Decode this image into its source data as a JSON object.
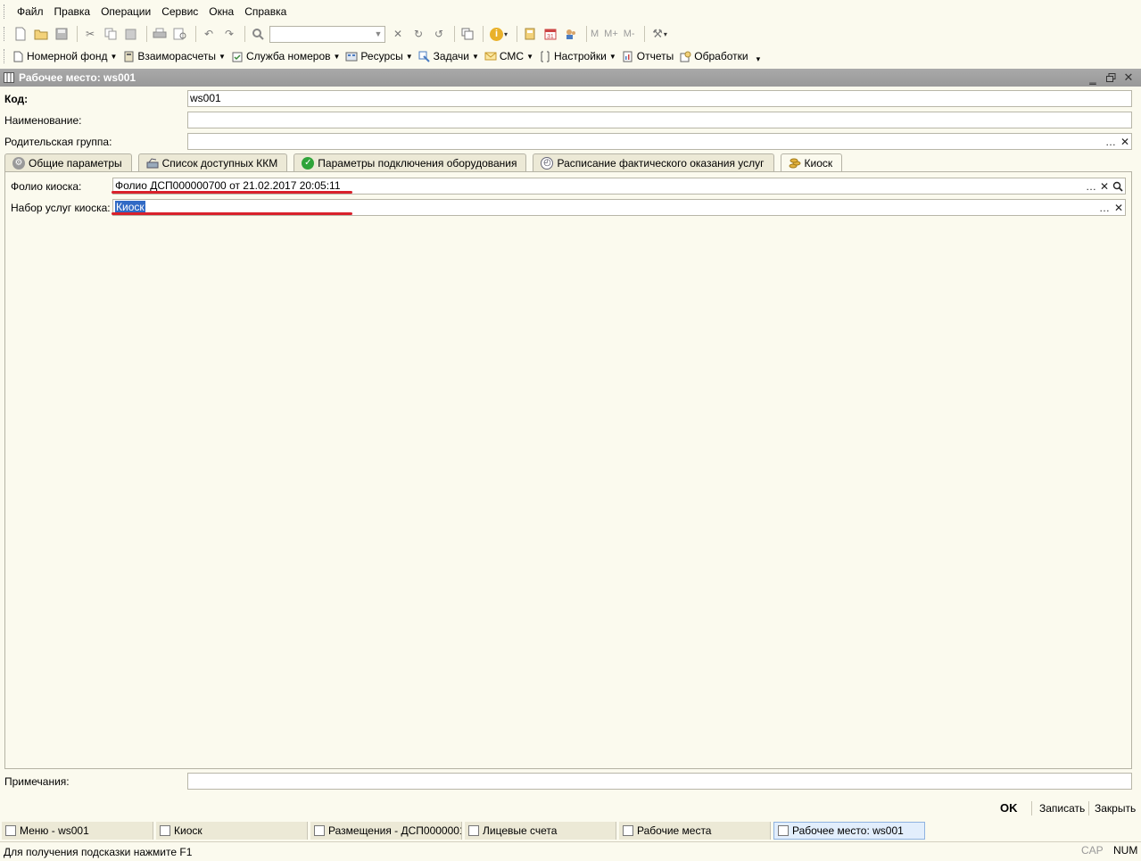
{
  "menu": {
    "items": [
      {
        "label": "Файл"
      },
      {
        "label": "Правка"
      },
      {
        "label": "Операции"
      },
      {
        "label": "Сервис"
      },
      {
        "label": "Окна"
      },
      {
        "label": "Справка"
      }
    ]
  },
  "toolbar1": {
    "search_value": "",
    "m_label": "M",
    "mplus_label": "M+",
    "mminus_label": "M-"
  },
  "toolbar2": {
    "items": [
      {
        "label": "Номерной фонд",
        "icon": "document-icon",
        "dropdown": true
      },
      {
        "label": "Взаиморасчеты",
        "icon": "calculator-icon",
        "dropdown": true
      },
      {
        "label": "Служба номеров",
        "icon": "clipboard-icon",
        "dropdown": true
      },
      {
        "label": "Ресурсы",
        "icon": "resources-icon",
        "dropdown": true
      },
      {
        "label": "Задачи",
        "icon": "tasks-icon",
        "dropdown": true
      },
      {
        "label": "СМС",
        "icon": "sms-icon",
        "dropdown": true
      },
      {
        "label": "Настройки",
        "icon": "settings-icon",
        "dropdown": true
      },
      {
        "label": "Отчеты",
        "icon": "report-icon",
        "dropdown": false
      },
      {
        "label": "Обработки",
        "icon": "processing-icon",
        "dropdown": false
      }
    ]
  },
  "window": {
    "title": "Рабочее место: ws001"
  },
  "form": {
    "code_label": "Код:",
    "code_value": "ws001",
    "name_label": "Наименование:",
    "name_value": "",
    "parent_label": "Родительская группа:",
    "parent_value": "",
    "notes_label": "Примечания:",
    "notes_value": ""
  },
  "tabs": [
    {
      "label": "Общие параметры",
      "icon": "gear-icon",
      "active": false
    },
    {
      "label": "Список доступных ККМ",
      "icon": "cash-register-icon",
      "active": false
    },
    {
      "label": "Параметры подключения оборудования",
      "icon": "check-icon",
      "active": false
    },
    {
      "label": "Расписание фактического оказания услуг",
      "icon": "clock-icon",
      "active": false
    },
    {
      "label": "Киоск",
      "icon": "coins-icon",
      "active": true
    }
  ],
  "kiosk": {
    "folio_label": "Фолио киоска:",
    "folio_value": "Фолио ДСП000000700 от 21.02.2017 20:05:11",
    "services_label": "Набор услуг киоска:",
    "services_value": "Киоск"
  },
  "buttons": {
    "ok": "OK",
    "save": "Записать",
    "close": "Закрыть"
  },
  "taskbar": [
    {
      "label": "Меню - ws001",
      "active": false
    },
    {
      "label": "Киоск",
      "active": false
    },
    {
      "label": "Размещения - ДСП0000001...",
      "active": false
    },
    {
      "label": "Лицевые счета",
      "active": false
    },
    {
      "label": "Рабочие места",
      "active": false
    },
    {
      "label": "Рабочее место: ws001",
      "active": true
    }
  ],
  "status": {
    "hint": "Для получения подсказки нажмите F1",
    "cap": "CAP",
    "num": "NUM"
  }
}
